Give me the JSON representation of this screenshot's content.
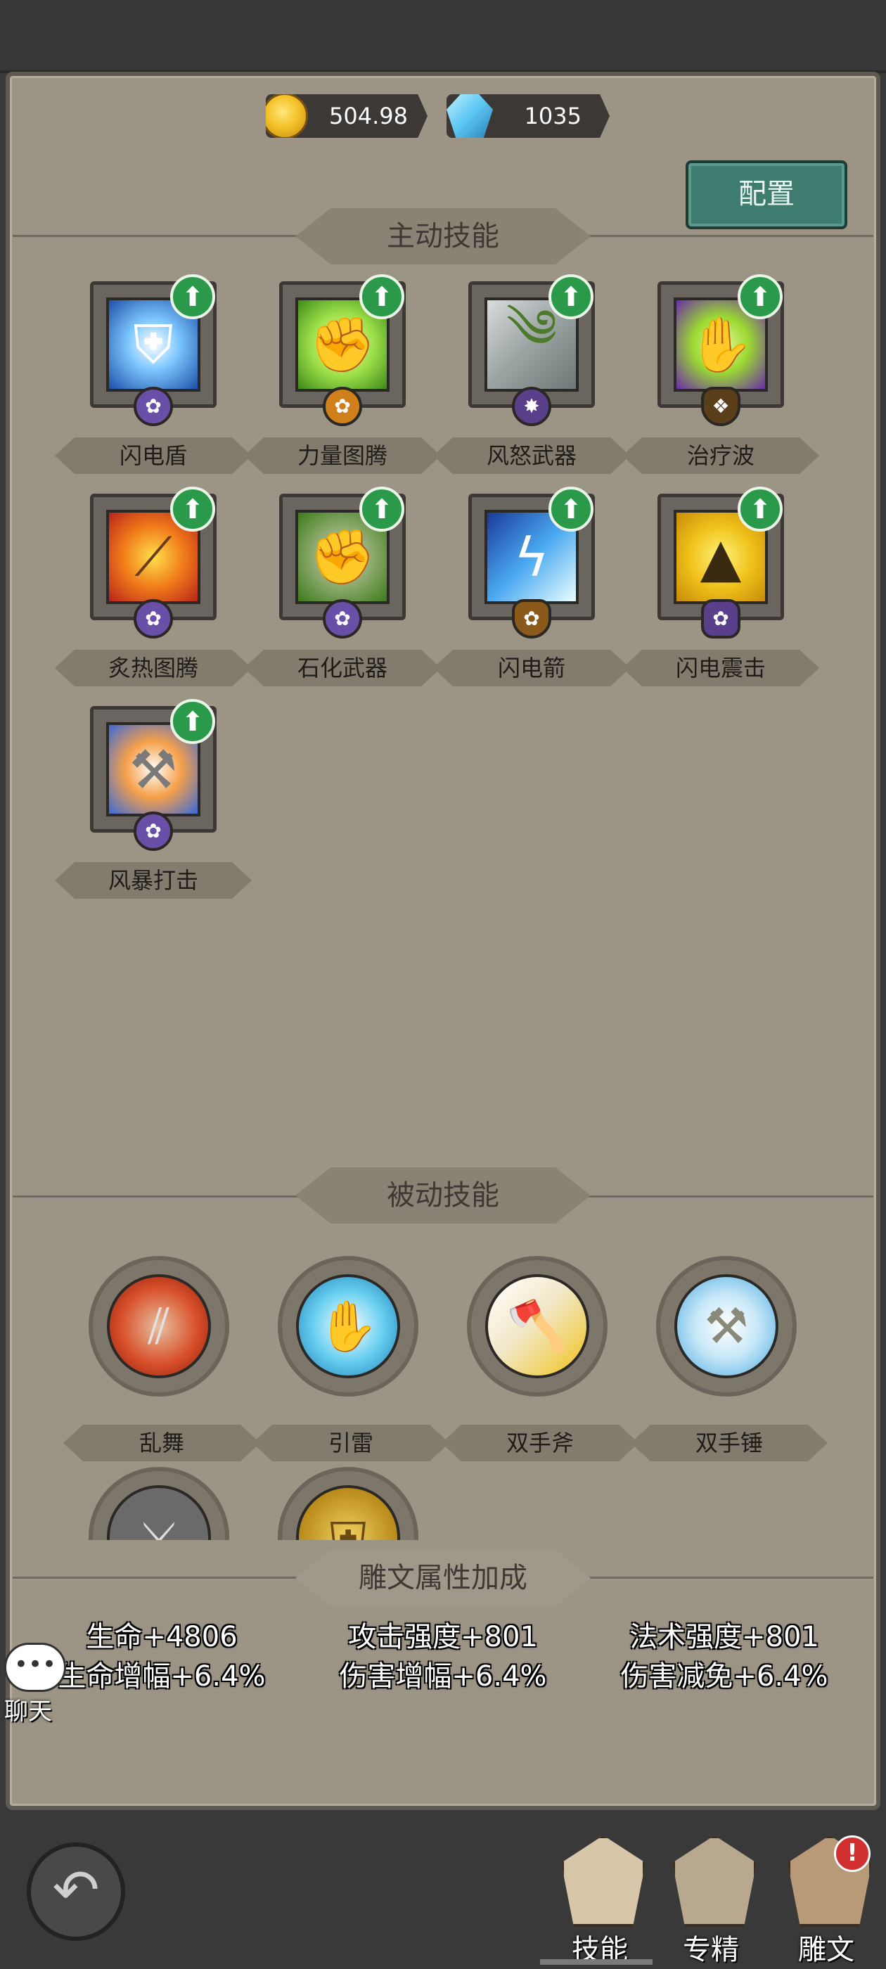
{
  "currency": {
    "gold": "504.98万",
    "gems": "1035"
  },
  "config_button": "配置",
  "sections": {
    "active": "主动技能",
    "passive": "被动技能",
    "runes": "雕文属性加成"
  },
  "active_skills": [
    {
      "name": "闪电盾"
    },
    {
      "name": "力量图腾"
    },
    {
      "name": "风怒武器"
    },
    {
      "name": "治疗波"
    },
    {
      "name": "炙热图腾"
    },
    {
      "name": "石化武器"
    },
    {
      "name": "闪电箭"
    },
    {
      "name": "闪电震击"
    },
    {
      "name": "风暴打击"
    }
  ],
  "passive_skills": [
    {
      "name": "乱舞"
    },
    {
      "name": "引雷"
    },
    {
      "name": "双手斧"
    },
    {
      "name": "双手锤"
    }
  ],
  "stats": {
    "col1_line1": "生命+4806",
    "col1_line2": "生命增幅+6.4%",
    "col2_line1": "攻击强度+801",
    "col2_line2": "伤害增幅+6.4%",
    "col3_line1": "法术强度+801",
    "col3_line2": "伤害减免+6.4%"
  },
  "chat": {
    "bubble": "•••",
    "label": "聊天"
  },
  "nav": {
    "skills": "技能",
    "mastery": "专精",
    "glyphs": "雕文",
    "alert": "!"
  },
  "colors": {
    "panel": "#9c9485",
    "config_button": "#3f7c70",
    "upgrade_badge": "#2a9a4a",
    "alert": "#d03030"
  }
}
